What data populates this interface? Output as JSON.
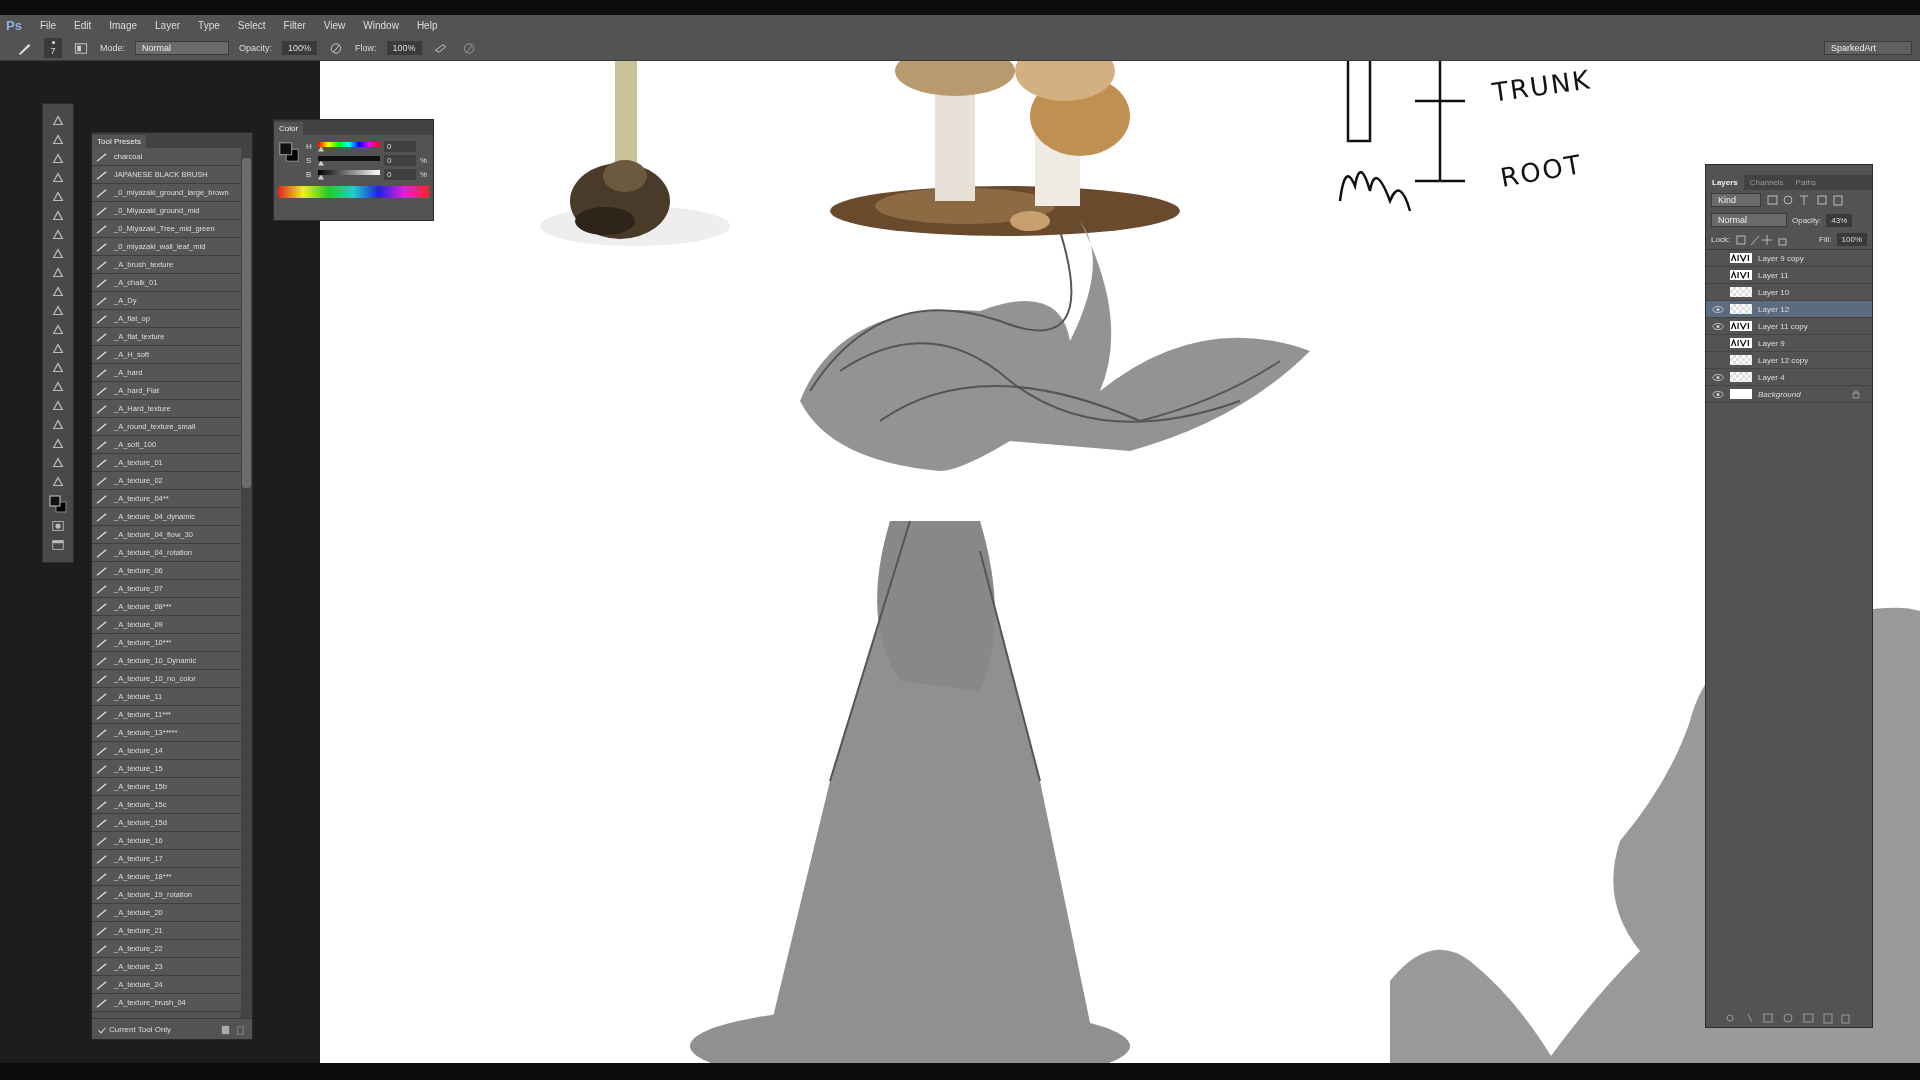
{
  "app_logo": "Ps",
  "menu": [
    "File",
    "Edit",
    "Image",
    "Layer",
    "Type",
    "Select",
    "Filter",
    "View",
    "Window",
    "Help"
  ],
  "options": {
    "brush_size": "7",
    "mode_label": "Mode:",
    "mode": "Normal",
    "opacity_label": "Opacity:",
    "opacity": "100%",
    "flow_label": "Flow:",
    "flow": "100%",
    "workspace": "SparkedArt"
  },
  "tool_presets": {
    "title": "Tool Presets",
    "items": [
      "charcoal",
      "JAPANESE BLACK BRUSH",
      "_0_miyazaki_ground_large_brown",
      "_0_Miyazaki_ground_mid",
      "_0_Miyazaki_Tree_mid_green",
      "_0_miyazaki_wall_leaf_mid",
      "_A_brush_texture",
      "_A_chalk_01",
      "_A_Dy",
      "_A_flat_op",
      "_A_flat_texture",
      "_A_H_soft",
      "_A_hard",
      "_A_hard_Flat",
      "_A_Hard_texture",
      "_A_round_texture_small",
      "_A_soft_100",
      "_A_texture_01",
      "_A_texture_02",
      "_A_texture_04**",
      "_A_texture_04_dynamic",
      "_A_texture_04_flow_30",
      "_A_texture_04_rotation",
      "_A_texture_06",
      "_A_texture_07",
      "_A_texture_08***",
      "_A_texture_09",
      "_A_texture_10***",
      "_A_texture_10_Dynamic",
      "_A_texture_10_no_color",
      "_A_texture_11",
      "_A_texture_11***",
      "_A_texture_13*****",
      "_A_texture_14",
      "_A_texture_15",
      "_A_texture_15b",
      "_A_texture_15c",
      "_A_texture_15d",
      "_A_texture_16",
      "_A_texture_17",
      "_A_texture_18***",
      "_A_texture_19_rotation",
      "_A_texture_20",
      "_A_texture_21",
      "_A_texture_22",
      "_A_texture_23",
      "_A_texture_24",
      "_A_texture_brush_04"
    ],
    "current_tool_only": {
      "label": "Current Tool Only",
      "checked": true
    }
  },
  "color": {
    "title": "Color",
    "channels": [
      {
        "label": "H",
        "value": "0",
        "level": 0
      },
      {
        "label": "S",
        "value": "0",
        "unit": "%",
        "level": 0
      },
      {
        "label": "B",
        "value": "0",
        "unit": "%",
        "level": 0
      }
    ]
  },
  "canvas_notes": [
    "TRUNK",
    "ROOT"
  ],
  "layers": {
    "tabs": [
      {
        "label": "Layers",
        "selected": true
      },
      {
        "label": "Channels",
        "selected": false
      },
      {
        "label": "Paths",
        "selected": false
      }
    ],
    "filter": "Kind",
    "blend": "Normal",
    "opacity_label": "Opacity:",
    "opacity": "43%",
    "lock_label": "Lock:",
    "fill_label": "Fill:",
    "fill": "100%",
    "items": [
      {
        "name": "Layer 9 copy",
        "visible": false,
        "selected": false,
        "kind": "sketch"
      },
      {
        "name": "Layer 11",
        "visible": false,
        "selected": false,
        "kind": "sketch"
      },
      {
        "name": "Layer 10",
        "visible": false,
        "selected": false,
        "kind": "transparent"
      },
      {
        "name": "Layer 12",
        "visible": true,
        "selected": true,
        "kind": "transparent"
      },
      {
        "name": "Layer 11 copy",
        "visible": true,
        "selected": false,
        "kind": "sketch"
      },
      {
        "name": "Layer 9",
        "visible": false,
        "selected": false,
        "kind": "sketch"
      },
      {
        "name": "Layer 12 copy",
        "visible": false,
        "selected": false,
        "kind": "transparent"
      },
      {
        "name": "Layer 4",
        "visible": true,
        "selected": false,
        "kind": "transparent"
      },
      {
        "name": "Background",
        "visible": true,
        "selected": false,
        "kind": "white",
        "locked": true
      }
    ]
  }
}
